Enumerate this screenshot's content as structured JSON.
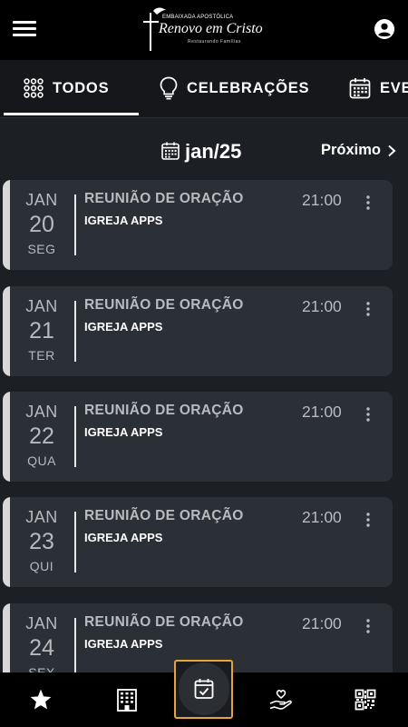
{
  "header": {
    "logo_small": "EMBAIXADA APOSTÓLICA",
    "logo_main": "Renovo em Cristo",
    "logo_sub": "Restaurando Famílias"
  },
  "tabs": [
    {
      "label": "TODOS",
      "icon": "grid-dots-icon",
      "active": true
    },
    {
      "label": "CELEBRAÇÕES",
      "icon": "lightbulb-icon",
      "active": false
    },
    {
      "label": "EVE",
      "icon": "calendar-icon",
      "active": false
    }
  ],
  "month_nav": {
    "month": "jan/25",
    "next_label": "Próximo"
  },
  "events": [
    {
      "month": "JAN",
      "day": "20",
      "weekday": "SEG",
      "title": "REUNIÃO DE ORAÇÃO",
      "subtitle": "IGREJA APPS",
      "time": "21:00"
    },
    {
      "month": "JAN",
      "day": "21",
      "weekday": "TER",
      "title": "REUNIÃO DE ORAÇÃO",
      "subtitle": "IGREJA APPS",
      "time": "21:00"
    },
    {
      "month": "JAN",
      "day": "22",
      "weekday": "QUA",
      "title": "REUNIÃO DE ORAÇÃO",
      "subtitle": "IGREJA APPS",
      "time": "21:00"
    },
    {
      "month": "JAN",
      "day": "23",
      "weekday": "QUI",
      "title": "REUNIÃO DE ORAÇÃO",
      "subtitle": "IGREJA APPS",
      "time": "21:00"
    },
    {
      "month": "JAN",
      "day": "24",
      "weekday": "SEX",
      "title": "REUNIÃO DE ORAÇÃO",
      "subtitle": "IGREJA APPS",
      "time": "21:00"
    }
  ],
  "bottom_nav": [
    {
      "icon": "star-icon"
    },
    {
      "icon": "building-icon"
    },
    {
      "icon": "calendar-check-icon",
      "active": true
    },
    {
      "icon": "hand-heart-icon"
    },
    {
      "icon": "qr-code-icon"
    }
  ],
  "colors": {
    "background": "#1c1f24",
    "card": "#2b2f36",
    "accent": "#e8a33a",
    "header": "#000000"
  }
}
